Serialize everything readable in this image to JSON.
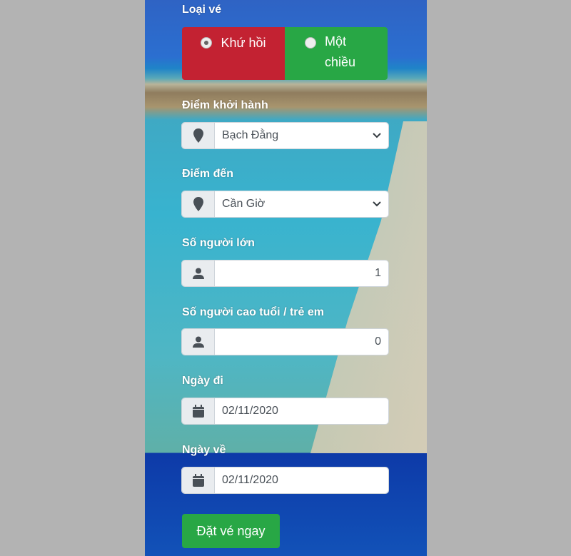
{
  "ticket_type": {
    "label": "Loại vé",
    "options": [
      {
        "label": "Khứ hồi",
        "selected": true,
        "color": "#c32232"
      },
      {
        "label": "Một chiều",
        "selected": false,
        "color": "#28a745"
      }
    ]
  },
  "departure": {
    "label": "Điểm khởi hành",
    "value": "Bạch Đằng",
    "icon": "map-marker-icon"
  },
  "destination": {
    "label": "Điểm đến",
    "value": "Cần Giờ",
    "icon": "map-marker-icon"
  },
  "adults": {
    "label": "Số người lớn",
    "value": "1",
    "icon": "user-icon"
  },
  "seniors_children": {
    "label": "Số người cao tuổi / trẻ em",
    "value": "0",
    "icon": "user-icon"
  },
  "depart_date": {
    "label": "Ngày đi",
    "value": "02/11/2020",
    "icon": "calendar-icon"
  },
  "return_date": {
    "label": "Ngày về",
    "value": "02/11/2020",
    "icon": "calendar-icon"
  },
  "submit": {
    "label": "Đặt vé ngay",
    "color": "#28a745"
  }
}
